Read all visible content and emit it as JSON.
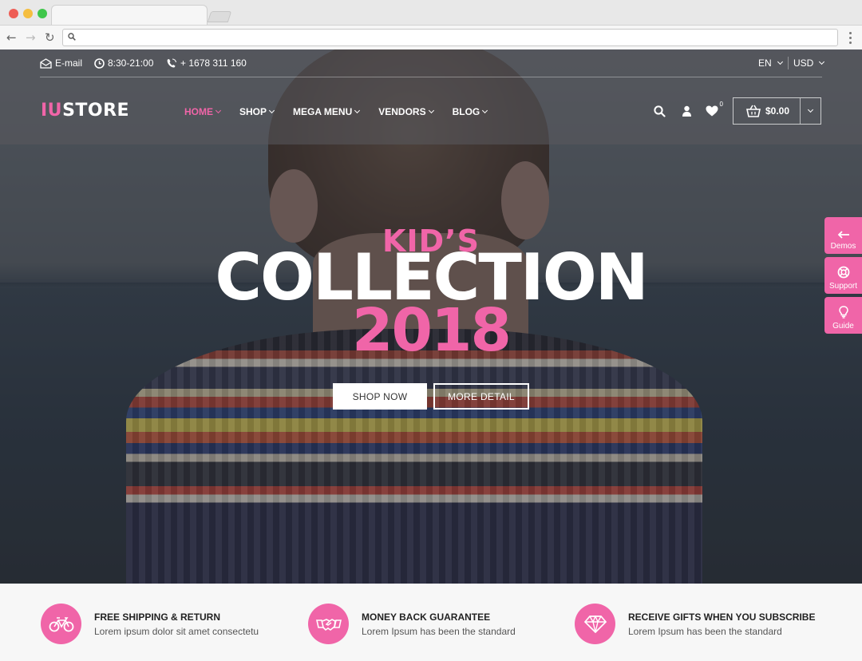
{
  "browser": {
    "url_value": "",
    "dots": [
      "#ee5d55",
      "#f5be3f",
      "#3fc64a"
    ]
  },
  "topbar": {
    "email": "E-mail",
    "hours": "8:30-21:00",
    "phone": "+ 1678 311 160",
    "language": "EN",
    "currency": "USD"
  },
  "brand": {
    "logo_accent": "IU",
    "logo_rest": "STORE"
  },
  "nav": {
    "items": [
      {
        "label": "HOME",
        "active": true
      },
      {
        "label": "SHOP",
        "active": false
      },
      {
        "label": "MEGA MENU",
        "active": false
      },
      {
        "label": "VENDORS",
        "active": false
      },
      {
        "label": "BLOG",
        "active": false
      }
    ]
  },
  "header_icons": {
    "icons": [
      "search-icon",
      "user-icon",
      "heart-icon",
      "basket-icon"
    ],
    "wishlist_count": "0",
    "cart_total": "$0.00"
  },
  "hero": {
    "line1": "KID’S",
    "line2": "COLLECTION",
    "line3": "2018",
    "shop_now": "SHOP NOW",
    "more_detail": "MORE DETAIL"
  },
  "side_panel": {
    "demos": "Demos",
    "support": "Support",
    "guide": "Guide"
  },
  "features": [
    {
      "icon": "bicycle-icon",
      "title": "FREE SHIPPING & RETURN",
      "desc": "Lorem ipsum dolor sit amet consectetu"
    },
    {
      "icon": "handshake-icon",
      "title": "MONEY BACK GUARANTEE",
      "desc": "Lorem Ipsum has been the standard"
    },
    {
      "icon": "diamond-icon",
      "title": "RECEIVE GIFTS WHEN YOU SUBSCRIBE",
      "desc": "Lorem Ipsum has been the standard"
    }
  ],
  "colors": {
    "accent": "#f065a8",
    "white": "#ffffff",
    "features_bg": "#f7f7f7"
  }
}
